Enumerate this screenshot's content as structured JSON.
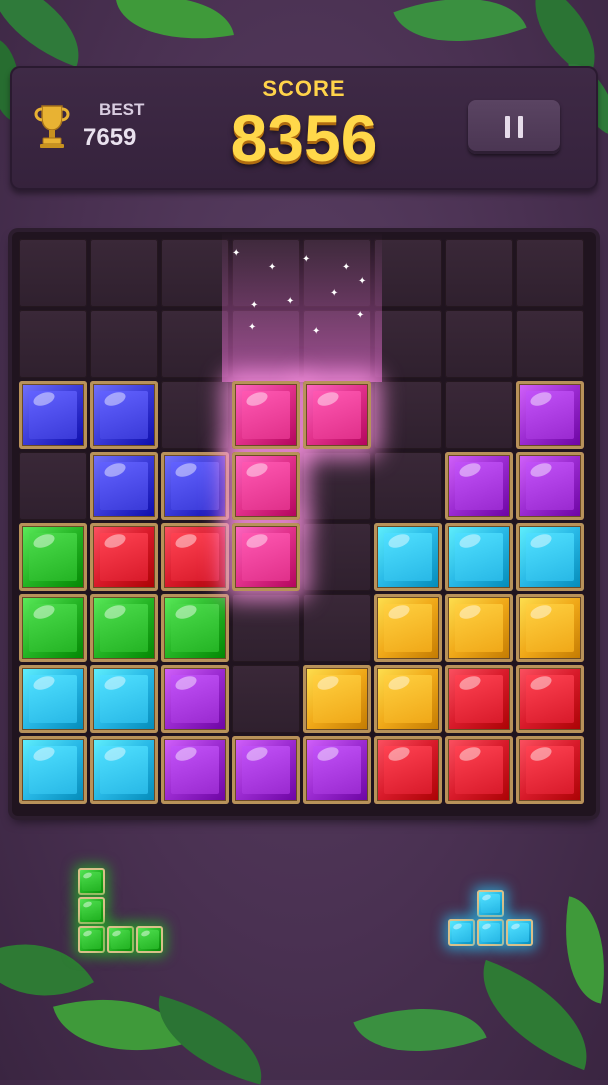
{
  "header": {
    "best_label": "BEST",
    "best_value": "7659",
    "score_label": "SCORE",
    "score_value": "8356"
  },
  "colors": {
    "blue": "#3a3ad8",
    "red": "#d81a2a",
    "green": "#24b424",
    "cyan": "#28b8e6",
    "yellow": "#f0a818",
    "purple": "#9a2ad0",
    "pink": "#e0308a"
  },
  "board": {
    "rows": [
      [
        "",
        "",
        "",
        "",
        "",
        "",
        "",
        ""
      ],
      [
        "",
        "",
        "",
        "",
        "",
        "",
        "",
        ""
      ],
      [
        "blue",
        "blue",
        "",
        "",
        "",
        "",
        "",
        "purple"
      ],
      [
        "",
        "blue",
        "blue",
        "",
        "",
        "",
        "purple",
        "purple"
      ],
      [
        "green",
        "red",
        "red",
        "",
        "",
        "cyan",
        "cyan",
        "cyan"
      ],
      [
        "green",
        "green",
        "green",
        "",
        "",
        "yellow",
        "yellow",
        "yellow"
      ],
      [
        "cyan",
        "cyan",
        "purple",
        "",
        "yellow",
        "yellow",
        "red",
        "red"
      ],
      [
        "cyan",
        "cyan",
        "purple",
        "purple",
        "purple",
        "red",
        "red",
        "red"
      ]
    ]
  },
  "dragged_piece": {
    "color": "pink",
    "cells": [
      [
        3,
        2
      ],
      [
        4,
        2
      ],
      [
        3,
        3
      ],
      [
        3,
        4
      ]
    ]
  },
  "tray": [
    {
      "color": "green",
      "cells": [
        [
          0,
          0
        ],
        [
          0,
          1
        ],
        [
          0,
          2
        ],
        [
          1,
          2
        ],
        [
          2,
          2
        ]
      ]
    },
    {
      "color": "cyan",
      "cells": [
        [
          1,
          0
        ],
        [
          0,
          1
        ],
        [
          1,
          1
        ],
        [
          2,
          1
        ]
      ]
    }
  ]
}
